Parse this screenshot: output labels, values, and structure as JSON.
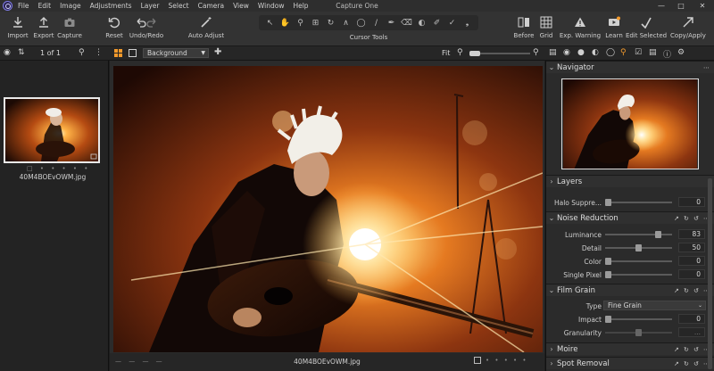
{
  "window": {
    "title": "Capture One"
  },
  "menu": [
    "File",
    "Edit",
    "Image",
    "Adjustments",
    "Layer",
    "Select",
    "Camera",
    "View",
    "Window",
    "Help"
  ],
  "toolbar": {
    "import": "Import",
    "export": "Export",
    "capture": "Capture",
    "reset": "Reset",
    "undo_redo": "Undo/Redo",
    "auto_adjust": "Auto Adjust",
    "cursor_tools": "Cursor Tools",
    "before": "Before",
    "grid": "Grid",
    "exp_warning": "Exp. Warning",
    "learn": "Learn",
    "edit_selected": "Edit Selected",
    "copy_apply": "Copy/Apply"
  },
  "browser": {
    "counter": "1 of 1",
    "file_name": "40M4BOEvOWM.jpg"
  },
  "viewer": {
    "background": "Background",
    "fit": "Fit",
    "file_name": "40M4BOEvOWM.jpg"
  },
  "tools": {
    "navigator": {
      "title": "Navigator"
    },
    "layers": {
      "title": "Layers",
      "halo_label": "Halo Suppre...",
      "halo_value": "0"
    },
    "noise_reduction": {
      "title": "Noise Reduction",
      "rows": [
        {
          "label": "Luminance",
          "value": "83",
          "level": 0.83
        },
        {
          "label": "Detail",
          "value": "50",
          "level": 0.5
        },
        {
          "label": "Color",
          "value": "0",
          "level": 0.0
        },
        {
          "label": "Single Pixel",
          "value": "0",
          "level": 0.0
        }
      ]
    },
    "film_grain": {
      "title": "Film Grain",
      "type_label": "Type",
      "type_value": "Fine Grain",
      "impact_label": "Impact",
      "impact_value": "0",
      "granularity_label": "Granularity",
      "granularity_value": "..."
    },
    "moire": {
      "title": "Moire"
    },
    "spot_removal": {
      "title": "Spot Removal"
    }
  },
  "colors": {
    "accent": "#f39a2c",
    "panel": "#2b2b2b",
    "toolbar": "#333333"
  }
}
